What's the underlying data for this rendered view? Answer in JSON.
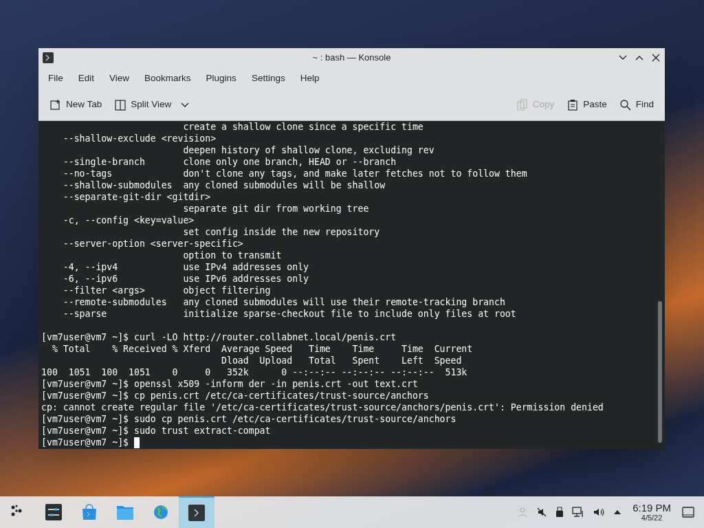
{
  "window": {
    "title": "~ : bash — Konsole"
  },
  "menu": [
    "File",
    "Edit",
    "View",
    "Bookmarks",
    "Plugins",
    "Settings",
    "Help"
  ],
  "toolbar": [
    {
      "kind": "newtab",
      "label": "New Tab",
      "disabled": false
    },
    {
      "kind": "split",
      "label": "Split View",
      "disabled": false
    },
    {
      "kind": "copy",
      "label": "Copy",
      "disabled": true
    },
    {
      "kind": "paste",
      "label": "Paste",
      "disabled": false
    },
    {
      "kind": "find",
      "label": "Find",
      "disabled": false
    }
  ],
  "terminal": {
    "help_output": [
      "                          create a shallow clone since a specific time",
      "    --shallow-exclude <revision>",
      "                          deepen history of shallow clone, excluding rev",
      "    --single-branch       clone only one branch, HEAD or --branch",
      "    --no-tags             don't clone any tags, and make later fetches not to follow them",
      "    --shallow-submodules  any cloned submodules will be shallow",
      "    --separate-git-dir <gitdir>",
      "                          separate git dir from working tree",
      "    -c, --config <key=value>",
      "                          set config inside the new repository",
      "    --server-option <server-specific>",
      "                          option to transmit",
      "    -4, --ipv4            use IPv4 addresses only",
      "    -6, --ipv6            use IPv6 addresses only",
      "    --filter <args>       object filtering",
      "    --remote-submodules   any cloned submodules will use their remote-tracking branch",
      "    --sparse              initialize sparse-checkout file to include only files at root"
    ],
    "session": [
      "[vm7user@vm7 ~]$ curl -LO http://router.collabnet.local/penis.crt",
      "  % Total    % Received % Xferd  Average Speed   Time    Time     Time  Current",
      "                                 Dload  Upload   Total   Spent    Left  Speed",
      "100  1051  100  1051    0     0   352k      0 --:--:-- --:--:-- --:--:--  513k",
      "[vm7user@vm7 ~]$ openssl x509 -inform der -in penis.crt -out text.crt",
      "[vm7user@vm7 ~]$ cp penis.crt /etc/ca-certificates/trust-source/anchors",
      "cp: cannot create regular file '/etc/ca-certificates/trust-source/anchors/penis.crt': Permission denied",
      "[vm7user@vm7 ~]$ sudo cp penis.crt /etc/ca-certificates/trust-source/anchors",
      "[vm7user@vm7 ~]$ sudo trust extract-compat"
    ],
    "prompt": {
      "text": "[vm7user@vm7 ~]$ ",
      "cursor": true
    }
  },
  "taskbar": {
    "items": [
      {
        "kind": "launcher",
        "selected": false
      },
      {
        "kind": "settings",
        "selected": false
      },
      {
        "kind": "store",
        "selected": false
      },
      {
        "kind": "files",
        "selected": false
      },
      {
        "kind": "browser",
        "selected": false
      },
      {
        "kind": "konsole",
        "selected": true
      }
    ],
    "clock": {
      "time": "6:19 PM",
      "date": "4/5/22"
    }
  }
}
